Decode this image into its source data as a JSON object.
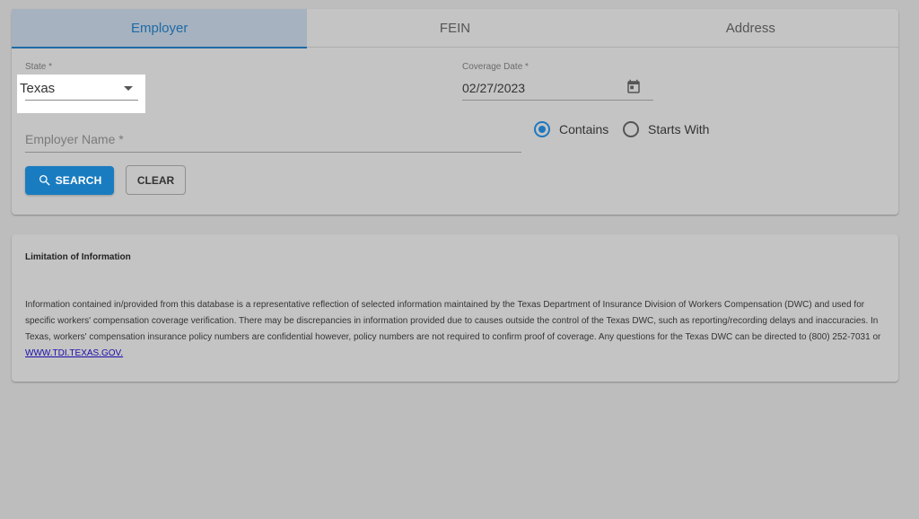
{
  "tabs": [
    {
      "label": "Employer",
      "active": true
    },
    {
      "label": "FEIN",
      "active": false
    },
    {
      "label": "Address",
      "active": false
    }
  ],
  "state_field": {
    "label": "State *",
    "value": "Texas"
  },
  "coverage_date": {
    "label": "Coverage Date *",
    "value": "02/27/2023",
    "icon": "calendar-icon"
  },
  "employer_name": {
    "placeholder": "Employer Name *",
    "value": ""
  },
  "match_mode": {
    "options": [
      {
        "label": "Contains",
        "checked": true
      },
      {
        "label": "Starts With",
        "checked": false
      }
    ]
  },
  "buttons": {
    "search": "SEARCH",
    "clear": "CLEAR",
    "search_icon": "magnifier-icon"
  },
  "info": {
    "title": "Limitation of Information",
    "body": "Information contained in/provided from this database is a representative reflection of selected information maintained by the Texas Department of Insurance Division of Workers Compensation (DWC) and used for specific workers' compensation coverage verification. There may be discrepancies in information provided due to causes outside the control of the Texas DWC, such as reporting/recording delays and inaccuracies. In Texas, workers' compensation insurance policy numbers are confidential however, policy numbers are not required to confirm proof of coverage. Any questions for the Texas DWC can be directed to (800) 252-7031 or ",
    "link_text": "WWW.TDI.TEXAS.GOV."
  },
  "colors": {
    "accent": "#1e6aa6",
    "button": "#1a7cc0",
    "overlay_bg": "#bdbdbd"
  }
}
